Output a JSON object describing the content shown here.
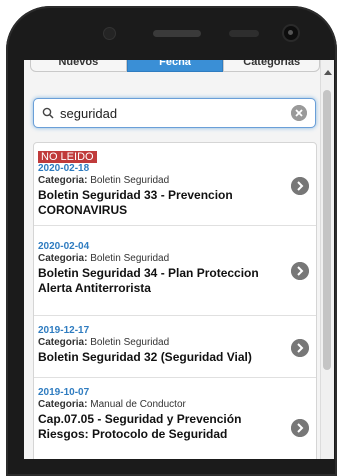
{
  "tabs": [
    "Nuevos",
    "Fecha",
    "Categorías"
  ],
  "search": {
    "value": "seguridad"
  },
  "items": [
    {
      "badge": "NO LEIDO",
      "date": "2020-02-18",
      "category_label": "Categoria:",
      "category": "Boletin Seguridad",
      "title": "Boletin Seguridad 33 - Prevencion CORONAVIRUS"
    },
    {
      "date": "2020-02-04",
      "category_label": "Categoria:",
      "category": "Boletin Seguridad",
      "title": "Boletin Seguridad 34 - Plan Proteccion Alerta Antiterrorista"
    },
    {
      "date": "2019-12-17",
      "category_label": "Categoria:",
      "category": "Boletin Seguridad",
      "title": "Boletin Seguridad 32 (Seguridad Vial)"
    },
    {
      "date": "2019-10-07",
      "category_label": "Categoria:",
      "category": "Manual de Conductor",
      "title": "Cap.07.05 - Seguridad y Prevención Riesgos: Protocolo de Seguridad"
    }
  ],
  "colors": {
    "accent": "#3a8fd6",
    "badge": "#c03b3b",
    "date": "#2f7cc0"
  }
}
